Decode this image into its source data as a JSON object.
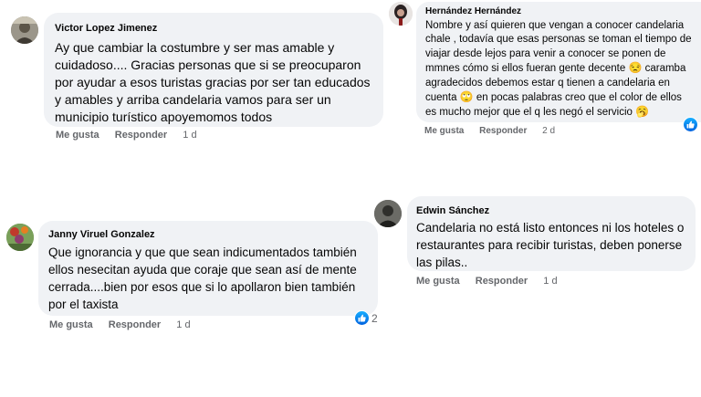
{
  "colors": {
    "bubble": "#f0f2f5",
    "meta": "#65676b",
    "like_blue": "#1877f2"
  },
  "comments": [
    {
      "author": "Victor Lopez Jimenez",
      "text": "Ay que cambiar la costumbre y ser mas amable y cuidadoso.... Gracias personas que si se preocuparon por ayudar a esos turistas gracias por ser tan educados y amables y arriba candelaria vamos para ser un municipio turístico apoyemomos todos",
      "like": "Me gusta",
      "reply": "Responder",
      "time": "1 d"
    },
    {
      "author": "Hernández Hernández",
      "text_parts": [
        "Nombre y así quieren que vengan a conocer candelaria chale , todavía que esas personas se toman el tiempo de viajar desde lejos para venir a conocer se ponen de mmnes cómo si ellos fueran gente decente ",
        " caramba agradecidos debemos estar q tienen a candelaria en cuenta ",
        " en pocas palabras creo que el color de ellos es mucho mejor que el q les negó el servicio ",
        ""
      ],
      "emojis": [
        "😒",
        "🙄",
        "🥱"
      ],
      "like": "Me gusta",
      "reply": "Responder",
      "time": "2 d"
    },
    {
      "author": "Janny Viruel Gonzalez",
      "text": "Que ignorancia y que que sean indicumentados también ellos nesecitan ayuda que coraje que sean así de mente cerrada....bien por esos que si lo apollaron bien también por el taxista",
      "like": "Me gusta",
      "reply": "Responder",
      "time": "1 d",
      "reaction_count": "2",
      "reaction_icon": "thumbs-up-icon"
    },
    {
      "author": "Edwin Sánchez",
      "text": "Candelaria no está listo entonces ni los hoteles o restaurantes para recibir turistas, deben ponerse las pilas..",
      "like": "Me gusta",
      "reply": "Responder",
      "time": "1 d"
    }
  ]
}
